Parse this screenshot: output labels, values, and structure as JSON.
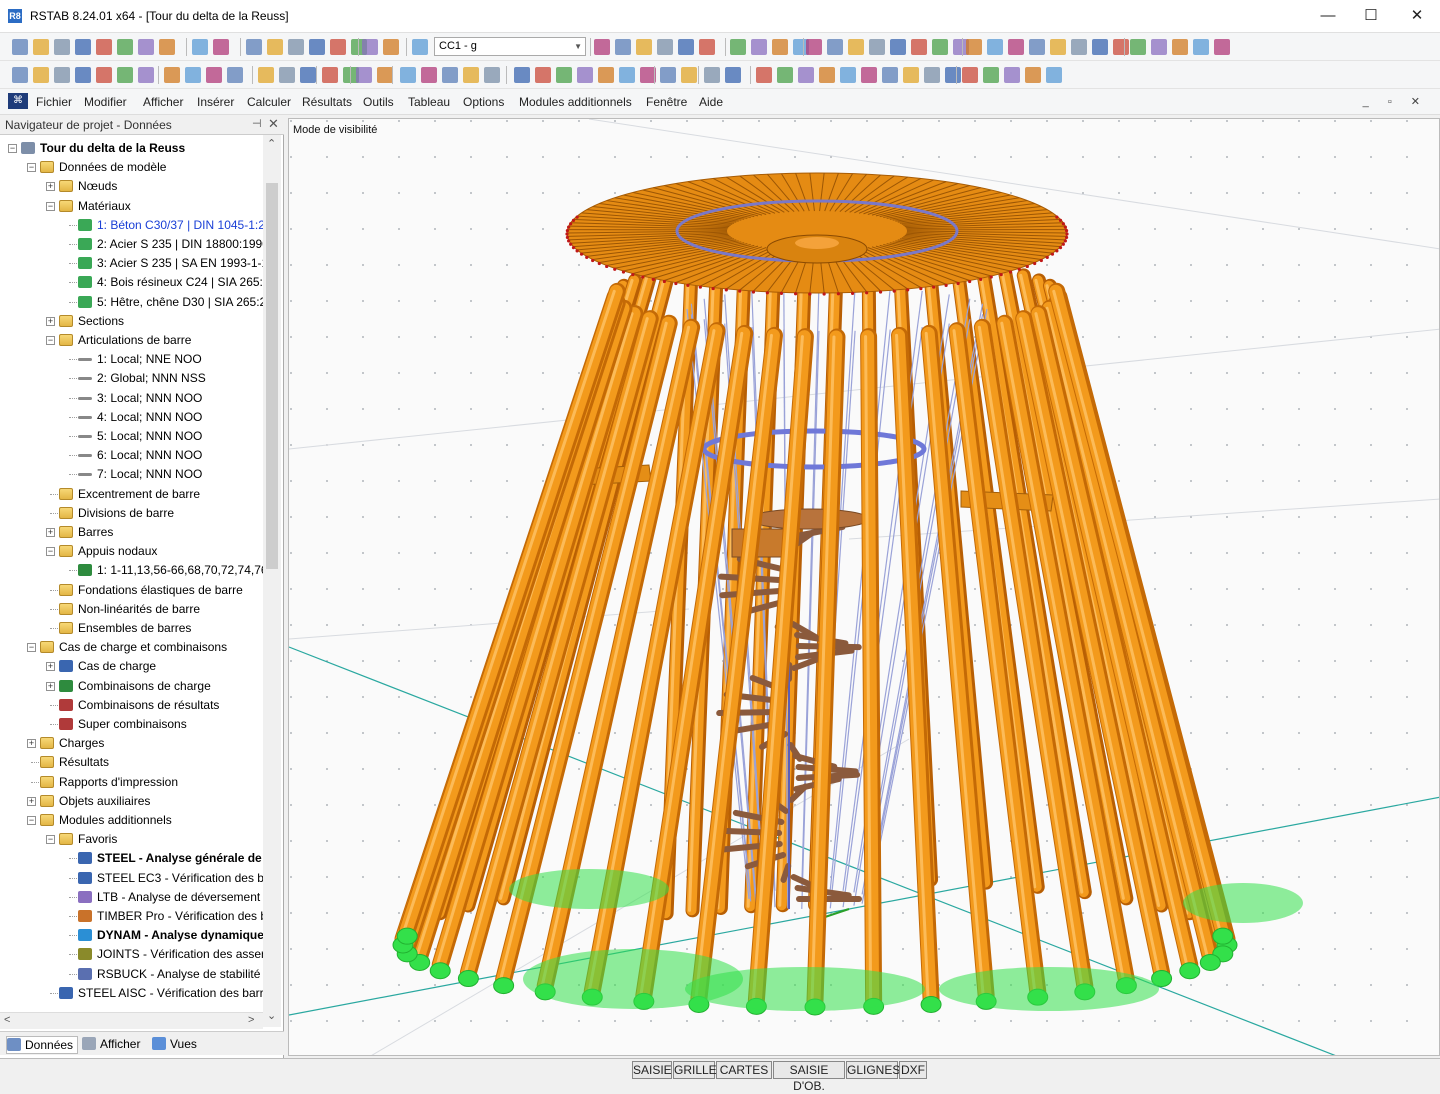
{
  "window": {
    "title": "RSTAB 8.24.01 x64 - [Tour du delta de la Reuss]",
    "app_icon_text": "R8",
    "minimize": "—",
    "maximize": "☐",
    "close": "✕"
  },
  "toolbar": {
    "load_case_combo": "CC1 - g"
  },
  "menu": {
    "items": [
      "Fichier",
      "Modifier",
      "Afficher",
      "Insérer",
      "Calculer",
      "Résultats",
      "Outils",
      "Tableau",
      "Options",
      "Modules additionnels",
      "Fenêtre",
      "Aide"
    ],
    "mdi_controls": "_ ▫ ✕"
  },
  "navigator": {
    "title": "Navigateur de projet - Données",
    "pin": "⊣",
    "close": "✕",
    "tree": [
      {
        "label": "Tour du delta de la Reuss",
        "level": 0,
        "bold": true,
        "toggle": "−",
        "icon": "project-icon"
      },
      {
        "label": "Données de modèle",
        "level": 1,
        "toggle": "−",
        "icon": "folder-open-icon"
      },
      {
        "label": "Nœuds",
        "level": 2,
        "toggle": "+",
        "icon": "folder-icon"
      },
      {
        "label": "Matériaux",
        "level": 2,
        "toggle": "−",
        "icon": "folder-open-icon"
      },
      {
        "label": "1: Béton C30/37 | DIN 1045-1:2",
        "level": 3,
        "color": "#1a3fd6",
        "icon": "material-icon"
      },
      {
        "label": "2: Acier S 235 | DIN 18800:1990-",
        "level": 3,
        "icon": "material-icon"
      },
      {
        "label": "3: Acier S 235 | SA EN 1993-1-1",
        "level": 3,
        "icon": "material-icon"
      },
      {
        "label": "4: Bois résineux C24 | SIA 265:2",
        "level": 3,
        "icon": "material-icon"
      },
      {
        "label": "5: Hêtre, chêne D30 | SIA 265:2",
        "level": 3,
        "icon": "material-icon"
      },
      {
        "label": "Sections",
        "level": 2,
        "toggle": "+",
        "icon": "folder-icon"
      },
      {
        "label": "Articulations de barre",
        "level": 2,
        "toggle": "−",
        "icon": "folder-open-icon"
      },
      {
        "label": "1: Local; NNE NOO",
        "level": 3,
        "icon": "hinge-icon"
      },
      {
        "label": "2: Global; NNN NSS",
        "level": 3,
        "icon": "hinge-icon"
      },
      {
        "label": "3: Local; NNN NOO",
        "level": 3,
        "icon": "hinge-icon"
      },
      {
        "label": "4: Local; NNN NOO",
        "level": 3,
        "icon": "hinge-icon"
      },
      {
        "label": "5: Local; NNN NOO",
        "level": 3,
        "icon": "hinge-icon"
      },
      {
        "label": "6: Local; NNN NOO",
        "level": 3,
        "icon": "hinge-icon"
      },
      {
        "label": "7: Local; NNN NOO",
        "level": 3,
        "icon": "hinge-icon"
      },
      {
        "label": "Excentrement de barre",
        "level": 2,
        "icon": "folder-icon"
      },
      {
        "label": "Divisions de barre",
        "level": 2,
        "icon": "folder-icon"
      },
      {
        "label": "Barres",
        "level": 2,
        "toggle": "+",
        "icon": "folder-icon"
      },
      {
        "label": "Appuis nodaux",
        "level": 2,
        "toggle": "−",
        "icon": "folder-open-icon"
      },
      {
        "label": "1: 1-11,13,56-66,68,70,72,74,76,",
        "level": 3,
        "icon": "support-icon"
      },
      {
        "label": "Fondations élastiques de barre",
        "level": 2,
        "icon": "folder-icon"
      },
      {
        "label": "Non-linéarités de barre",
        "level": 2,
        "icon": "folder-icon"
      },
      {
        "label": "Ensembles de barres",
        "level": 2,
        "icon": "folder-icon"
      },
      {
        "label": "Cas de charge et combinaisons",
        "level": 1,
        "toggle": "−",
        "icon": "folder-open-icon"
      },
      {
        "label": "Cas de charge",
        "level": 2,
        "toggle": "+",
        "icon": "load-case-icon"
      },
      {
        "label": "Combinaisons de charge",
        "level": 2,
        "toggle": "+",
        "icon": "load-combination-icon"
      },
      {
        "label": "Combinaisons de résultats",
        "level": 2,
        "icon": "result-combination-icon"
      },
      {
        "label": "Super combinaisons",
        "level": 2,
        "icon": "super-combination-icon"
      },
      {
        "label": "Charges",
        "level": 1,
        "toggle": "+",
        "icon": "folder-icon"
      },
      {
        "label": "Résultats",
        "level": 1,
        "icon": "folder-icon"
      },
      {
        "label": "Rapports d'impression",
        "level": 1,
        "icon": "folder-icon"
      },
      {
        "label": "Objets auxiliaires",
        "level": 1,
        "toggle": "+",
        "icon": "folder-icon"
      },
      {
        "label": "Modules additionnels",
        "level": 1,
        "toggle": "−",
        "icon": "folder-open-icon"
      },
      {
        "label": "Favoris",
        "level": 2,
        "toggle": "−",
        "icon": "folder-open-icon"
      },
      {
        "label": "STEEL - Analyse générale de c",
        "level": 3,
        "bold": true,
        "icon": "steel-module-icon"
      },
      {
        "label": "STEEL EC3 - Vérification des ba",
        "level": 3,
        "icon": "steel-ec3-module-icon"
      },
      {
        "label": "LTB - Analyse de déversement",
        "level": 3,
        "icon": "ltb-module-icon"
      },
      {
        "label": "TIMBER Pro - Vérification des b",
        "level": 3,
        "icon": "timber-module-icon"
      },
      {
        "label": "DYNAM - Analyse dynamique",
        "level": 3,
        "bold": true,
        "icon": "dynam-module-icon"
      },
      {
        "label": "JOINTS - Vérification des asser",
        "level": 3,
        "icon": "joints-module-icon"
      },
      {
        "label": "RSBUCK - Analyse de stabilité",
        "level": 3,
        "icon": "rsbuck-module-icon"
      },
      {
        "label": "STEEL AISC - Vérification des barre",
        "level": 2,
        "icon": "aisc-module-icon"
      }
    ],
    "scroll": {
      "up": "⌃",
      "down": "⌄",
      "left": "<",
      "right": ">"
    },
    "tabs": [
      "Données",
      "Afficher",
      "Vues"
    ]
  },
  "viewport": {
    "mode_label": "Mode de visibilité"
  },
  "status_buttons": [
    "SAISIE",
    "GRILLE",
    "CARTES",
    "SAISIE D'OB.",
    "GLIGNES",
    "DXF"
  ],
  "colors": {
    "member": "#f39a1c",
    "stair": "#8b5a3c",
    "support": "#33e04a",
    "axis": "#2aa8a0",
    "accent_blue": "#1a3fd6"
  }
}
